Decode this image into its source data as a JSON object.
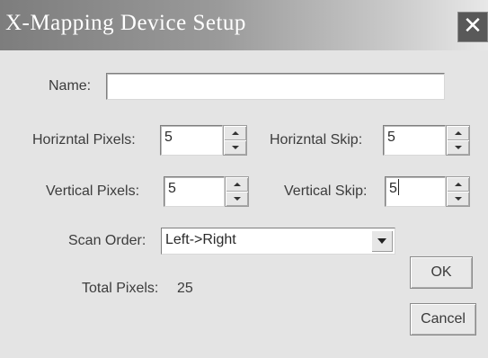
{
  "window": {
    "title": "X-Mapping Device Setup",
    "close_symbol": "✕"
  },
  "form": {
    "name_label": "Name:",
    "name_value": "",
    "h_pixels_label": "Horizntal Pixels:",
    "h_pixels_value": "5",
    "h_skip_label": "Horizntal Skip:",
    "h_skip_value": "5",
    "v_pixels_label": "Vertical Pixels:",
    "v_pixels_value": "5",
    "v_skip_label": "Vertical Skip:",
    "v_skip_value": "5",
    "scan_order_label": "Scan Order:",
    "scan_order_value": "Left->Right",
    "total_pixels_label": "Total Pixels:",
    "total_pixels_value": "25"
  },
  "buttons": {
    "ok": "OK",
    "cancel": "Cancel"
  },
  "icons": {
    "close": "close-icon",
    "spin_up": "spin-up-arrow-icon",
    "spin_down": "spin-down-arrow-icon",
    "dropdown": "chevron-down-icon"
  }
}
